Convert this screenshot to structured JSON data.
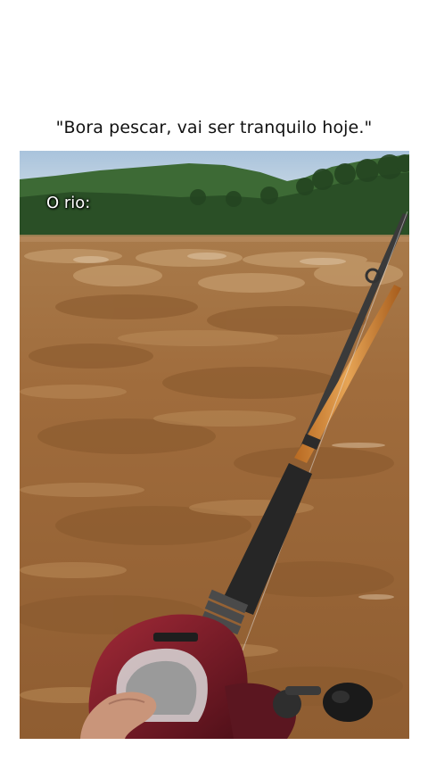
{
  "caption": "\"Bora pescar, vai ser tranquilo hoje.\"",
  "overlay_label": "O rio:",
  "colors": {
    "sky": "#b9cde0",
    "hills": "#2f5a2c",
    "river": "#9b6a3a",
    "rod": "#d08a3e",
    "grip": "#2a2a2a",
    "reel": "#7c1e2a"
  }
}
